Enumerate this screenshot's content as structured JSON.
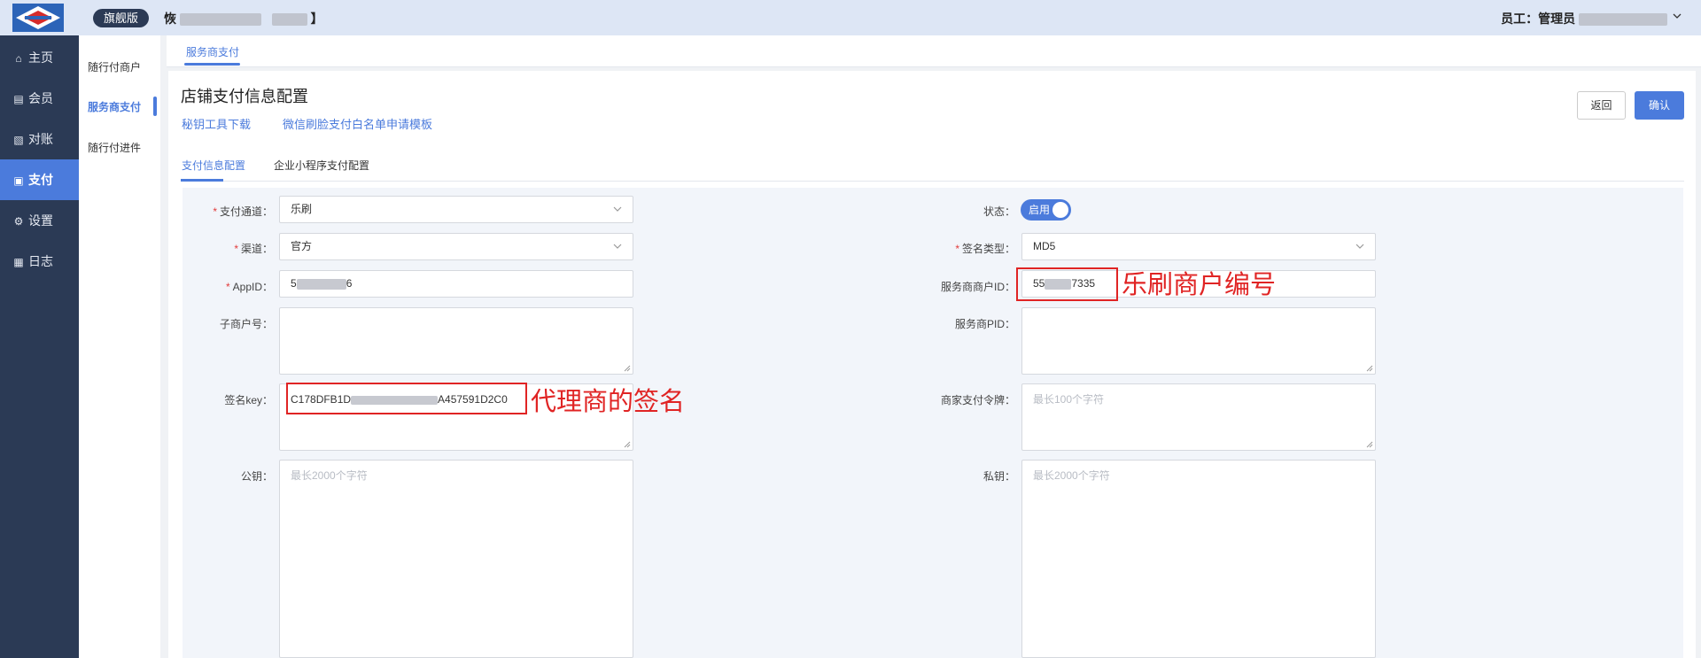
{
  "header": {
    "logo_icon": "brand-logo",
    "edition": "旗舰版",
    "store_name_start": "恢",
    "store_name_end": "】",
    "user_label": "员工：管理员",
    "caret_icon": "chevron-down-icon"
  },
  "sidebar": {
    "items": [
      {
        "icon": "home-icon",
        "label": "主页"
      },
      {
        "icon": "member-icon",
        "label": "会员"
      },
      {
        "icon": "reconcile-icon",
        "label": "对账"
      },
      {
        "icon": "payment-icon",
        "label": "支付"
      },
      {
        "icon": "settings-icon",
        "label": "设置"
      },
      {
        "icon": "log-icon",
        "label": "日志"
      }
    ],
    "active": "支付"
  },
  "subsidebar": {
    "items": [
      "随行付商户",
      "服务商支付",
      "随行付进件"
    ],
    "active": "服务商支付"
  },
  "tabs": {
    "current": "服务商支付"
  },
  "page": {
    "title": "店铺支付信息配置",
    "link_key_download": "秘钥工具下载",
    "link_whitelist_template": "微信刷脸支付白名单申请模板",
    "btn_back": "返回",
    "btn_confirm": "确认",
    "subtab_pay_config": "支付信息配置",
    "subtab_miniprogram": "企业小程序支付配置"
  },
  "form": {
    "channel_label": "支付通道：",
    "channel_value": "乐刷",
    "route_label": "渠道：",
    "route_value": "官方",
    "appid_label": "AppID：",
    "appid_value_start": "5",
    "appid_value_end": "6",
    "sub_merchant_label": "子商户号：",
    "sign_key_label": "签名key：",
    "sign_key_start": "C178DFB1D",
    "sign_key_end": "A457591D2C0",
    "public_key_label": "公钥：",
    "public_key_placeholder": "最长2000个字符",
    "status_label": "状态：",
    "status_value": "启用",
    "sign_type_label": "签名类型：",
    "sign_type_value": "MD5",
    "merchant_id_label": "服务商商户ID：",
    "merchant_id_start": "55",
    "merchant_id_end": "7335",
    "pid_label": "服务商PID：",
    "token_label": "商家支付令牌：",
    "token_placeholder": "最长100个字符",
    "private_key_label": "私钥：",
    "private_key_placeholder": "最长2000个字符"
  },
  "annotations": {
    "merchant_note": "乐刷商户编号",
    "sign_note": "代理商的签名",
    "color": "#e02424"
  },
  "colors": {
    "accent": "#4b7bdc",
    "sidebar_bg": "#2b3a55",
    "header_bg": "#dde6f5"
  }
}
